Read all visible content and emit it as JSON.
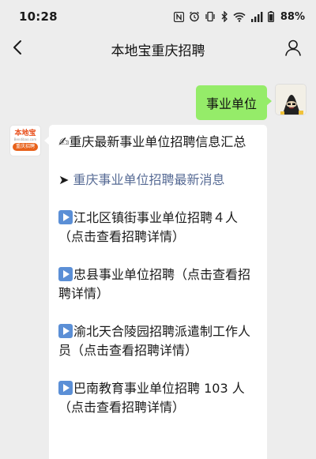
{
  "status_bar": {
    "time": "10:28",
    "battery": "88%",
    "icons": [
      "nfc-icon",
      "alarm-icon",
      "vibrate-icon",
      "bluetooth-icon",
      "wifi-icon",
      "signal-icon",
      "battery-icon"
    ]
  },
  "nav": {
    "title": "本地宝重庆招聘",
    "back_icon": "chevron-left-icon",
    "profile_icon": "user-icon"
  },
  "sent_message": {
    "text": "事业单位"
  },
  "bot": {
    "avatar_logo_text": "本地宝",
    "avatar_logo_sub": "Bendibao.com",
    "avatar_badge": "重庆招聘"
  },
  "received_message": {
    "header_emoji": "✍",
    "header_text": "重庆最新事业单位招聘信息汇总",
    "latest_arrow": "➤",
    "latest_link": "重庆事业单位招聘最新消息",
    "items": [
      {
        "text": "江北区镇街事业单位招聘４人（点击查看招聘详情）"
      },
      {
        "text": "忠县事业单位招聘（点击查看招聘详情）"
      },
      {
        "text": "渝北天合陵园招聘派遣制工作人员（点击查看招聘详情）"
      },
      {
        "text": "巴南教育事业单位招聘 103 人（点击查看招聘详情）"
      }
    ]
  },
  "colors": {
    "background": "#ededed",
    "sent_bubble": "#95ec69",
    "link": "#576b95",
    "play_icon": "#5b8fd6",
    "brand_orange": "#e8611a"
  }
}
